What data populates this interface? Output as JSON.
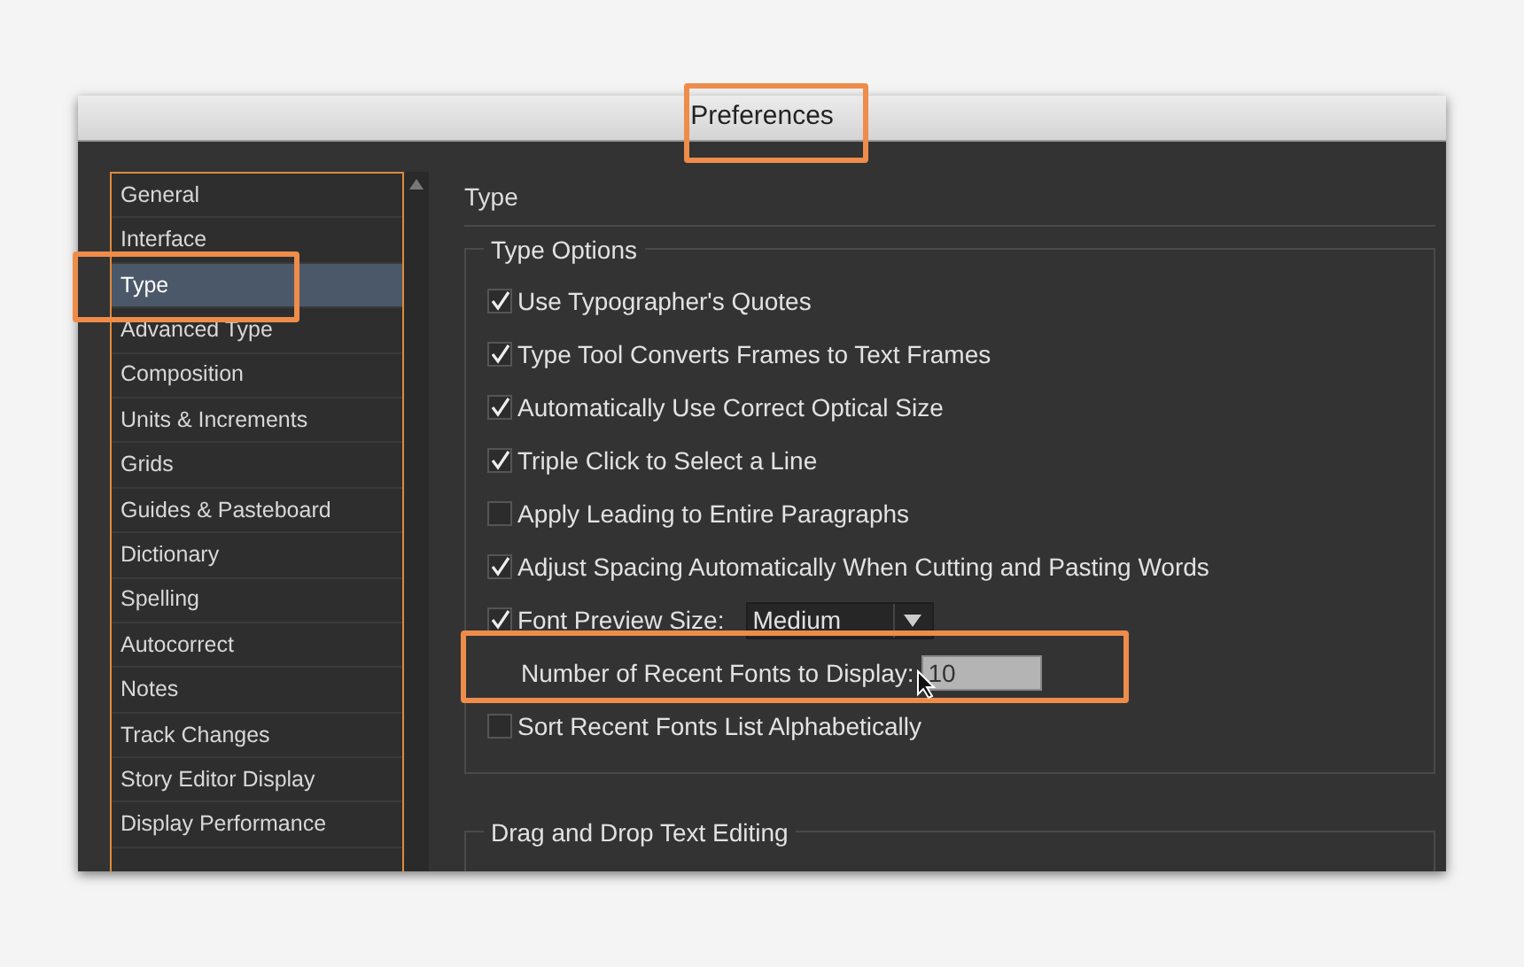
{
  "window": {
    "title": "Preferences"
  },
  "sidebar": {
    "items": [
      {
        "label": "General",
        "selected": false
      },
      {
        "label": "Interface",
        "selected": false
      },
      {
        "label": "Type",
        "selected": true
      },
      {
        "label": "Advanced Type",
        "selected": false
      },
      {
        "label": "Composition",
        "selected": false
      },
      {
        "label": "Units & Increments",
        "selected": false
      },
      {
        "label": "Grids",
        "selected": false
      },
      {
        "label": "Guides & Pasteboard",
        "selected": false
      },
      {
        "label": "Dictionary",
        "selected": false
      },
      {
        "label": "Spelling",
        "selected": false
      },
      {
        "label": "Autocorrect",
        "selected": false
      },
      {
        "label": "Notes",
        "selected": false
      },
      {
        "label": "Track Changes",
        "selected": false
      },
      {
        "label": "Story Editor Display",
        "selected": false
      },
      {
        "label": "Display Performance",
        "selected": false
      }
    ]
  },
  "panel": {
    "heading": "Type",
    "groups": [
      {
        "title": "Type Options",
        "options": [
          {
            "kind": "checkbox",
            "label": "Use Typographer's Quotes",
            "checked": true
          },
          {
            "kind": "checkbox",
            "label": "Type Tool Converts Frames to Text Frames",
            "checked": true
          },
          {
            "kind": "checkbox",
            "label": "Automatically Use Correct Optical Size",
            "checked": true
          },
          {
            "kind": "checkbox",
            "label": "Triple Click to Select a Line",
            "checked": true
          },
          {
            "kind": "checkbox",
            "label": "Apply Leading to Entire Paragraphs",
            "checked": false
          },
          {
            "kind": "checkbox",
            "label": "Adjust Spacing Automatically When Cutting and Pasting Words",
            "checked": true
          },
          {
            "kind": "dropdown",
            "label": "Font Preview Size:",
            "checked": true,
            "value": "Medium"
          },
          {
            "kind": "number",
            "label": "Number of Recent Fonts to Display:",
            "value": "10"
          },
          {
            "kind": "checkbox",
            "label": "Sort Recent Fonts List Alphabetically",
            "checked": false
          }
        ]
      },
      {
        "title": "Drag and Drop Text Editing"
      }
    ]
  }
}
